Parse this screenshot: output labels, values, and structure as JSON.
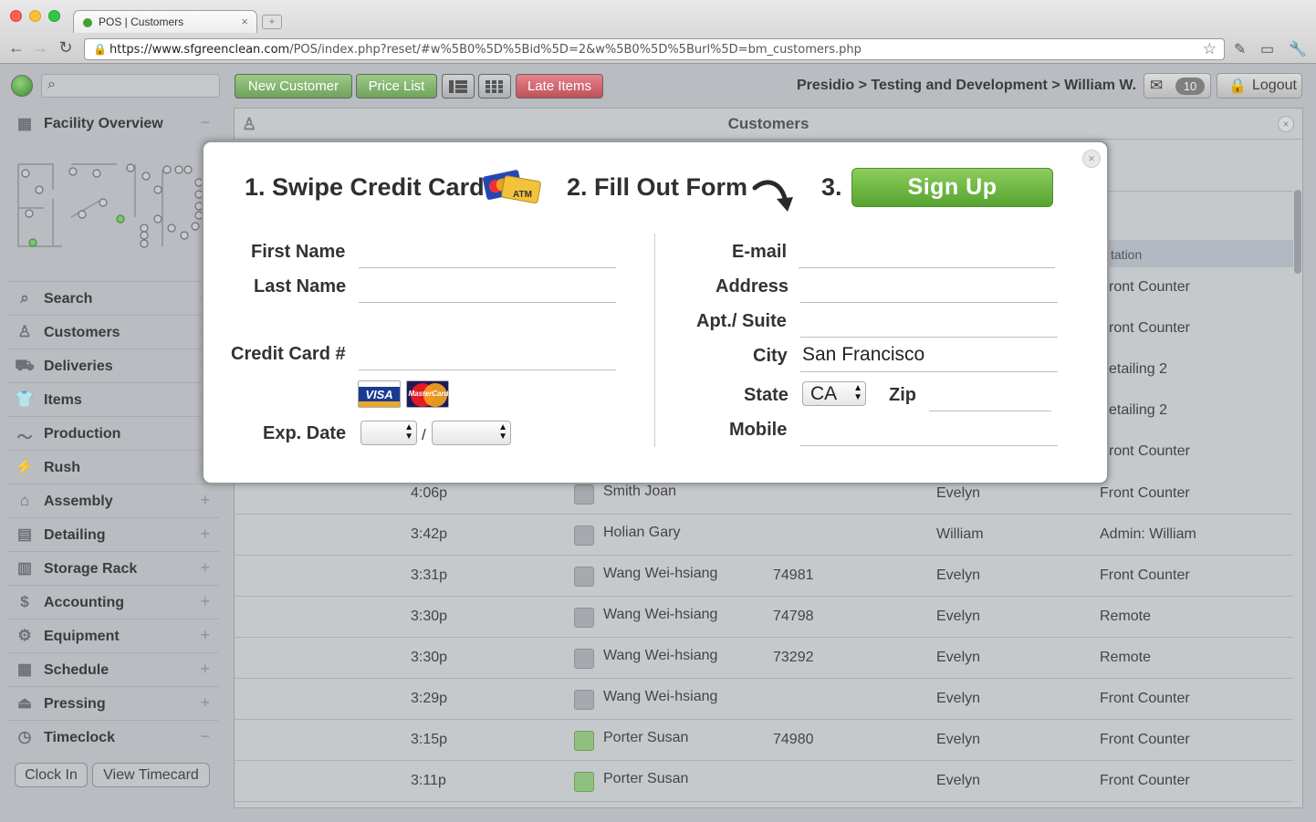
{
  "browser": {
    "tab_title": "POS | Customers",
    "tab_close": "×",
    "new_tab": "+",
    "url_host": "https://www.sfgreenclean.com",
    "url_path": "/POS/index.php?reset/#w%5B0%5D%5Bid%5D=2&w%5B0%5D%5Burl%5D=bm_customers.php"
  },
  "header": {
    "new_customer": "New Customer",
    "price_list": "Price List",
    "late_items": "Late Items",
    "breadcrumb": "Presidio > Testing and Development > William W.",
    "mail_count": "10",
    "logout": "Logout"
  },
  "sidebar": {
    "facility": "Facility Overview",
    "items": [
      {
        "label": "Search",
        "icon": "magnifier-icon",
        "mark": "+"
      },
      {
        "label": "Customers",
        "icon": "person-icon",
        "mark": "+"
      },
      {
        "label": "Deliveries",
        "icon": "truck-icon",
        "mark": "+"
      },
      {
        "label": "Items",
        "icon": "shirt-icon",
        "mark": "+"
      },
      {
        "label": "Production",
        "icon": "chart-line-icon",
        "mark": "+"
      },
      {
        "label": "Rush",
        "icon": "lightning-icon",
        "mark": "+"
      },
      {
        "label": "Assembly",
        "icon": "hanger-icon",
        "mark": "+"
      },
      {
        "label": "Detailing",
        "icon": "detail-icon",
        "mark": "+"
      },
      {
        "label": "Storage Rack",
        "icon": "rack-icon",
        "mark": "+"
      },
      {
        "label": "Accounting",
        "icon": "dollar-icon",
        "mark": "+"
      },
      {
        "label": "Equipment",
        "icon": "machine-icon",
        "mark": "+"
      },
      {
        "label": "Schedule",
        "icon": "calendar-icon",
        "mark": "+"
      },
      {
        "label": "Pressing",
        "icon": "iron-icon",
        "mark": "+"
      },
      {
        "label": "Timeclock",
        "icon": "clock-icon",
        "mark": "−"
      }
    ],
    "clock_in": "Clock In",
    "view_timecard": "View Timecard"
  },
  "panel": {
    "title": "Customers",
    "col_station_partial": "tation",
    "hidden_rows": [
      {
        "station": "ront Counter"
      },
      {
        "station": "ront Counter"
      },
      {
        "station": "etailing 2"
      },
      {
        "station": "etailing 2"
      },
      {
        "station": "ront Counter"
      }
    ],
    "rows": [
      {
        "time": "4:06p",
        "name": "Smith Joan",
        "ticket": "",
        "employee": "Evelyn",
        "station": "Front Counter",
        "avatar": "gray"
      },
      {
        "time": "3:42p",
        "name": "Holian Gary",
        "ticket": "",
        "employee": "William",
        "station": "Admin: William",
        "avatar": "gray"
      },
      {
        "time": "3:31p",
        "name": "Wang Wei-hsiang",
        "ticket": "74981",
        "employee": "Evelyn",
        "station": "Front Counter",
        "avatar": "gray"
      },
      {
        "time": "3:30p",
        "name": "Wang Wei-hsiang",
        "ticket": "74798",
        "employee": "Evelyn",
        "station": "Remote",
        "avatar": "gray"
      },
      {
        "time": "3:30p",
        "name": "Wang Wei-hsiang",
        "ticket": "73292",
        "employee": "Evelyn",
        "station": "Remote",
        "avatar": "gray"
      },
      {
        "time": "3:29p",
        "name": "Wang Wei-hsiang",
        "ticket": "",
        "employee": "Evelyn",
        "station": "Front Counter",
        "avatar": "gray"
      },
      {
        "time": "3:15p",
        "name": "Porter Susan",
        "ticket": "74980",
        "employee": "Evelyn",
        "station": "Front Counter",
        "avatar": "green"
      },
      {
        "time": "3:11p",
        "name": "Porter Susan",
        "ticket": "",
        "employee": "Evelyn",
        "station": "Front Counter",
        "avatar": "green"
      }
    ]
  },
  "modal": {
    "step1": "1. Swipe Credit Card",
    "card_badge": "ATM",
    "step2": "2. Fill Out Form",
    "step3": "3.",
    "signup": "Sign Up",
    "close": "×",
    "left_fields": {
      "first_name": "First Name",
      "last_name": "Last Name",
      "credit_card": "Credit Card #",
      "exp_date": "Exp. Date",
      "visa": "VISA",
      "mastercard": "MasterCard"
    },
    "right_fields": {
      "email": "E-mail",
      "address": "Address",
      "apt": "Apt./ Suite",
      "city": "City",
      "city_value": "San Francisco",
      "state": "State",
      "state_value": "CA",
      "zip": "Zip",
      "mobile": "Mobile"
    }
  },
  "colors": {
    "green_button": "#7cb267",
    "red_button": "#d06870",
    "signup_green": "#6db842"
  }
}
